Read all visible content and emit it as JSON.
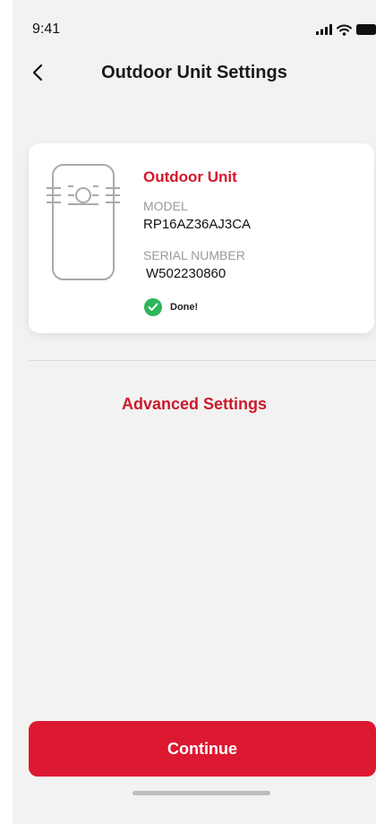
{
  "status_bar": {
    "time": "9:41",
    "icons": [
      "signal-icon",
      "wifi-icon",
      "battery-icon"
    ]
  },
  "nav": {
    "title": "Outdoor Unit Settings",
    "back_icon": "chevron-left-icon"
  },
  "unit_card": {
    "icon": "outdoor-unit-icon",
    "title": "Outdoor Unit",
    "model_label": "MODEL",
    "model_value": "RP16AZ36AJ3CA",
    "serial_label": "SERIAL NUMBER",
    "serial_value": "W502230860",
    "status_text": "Done!",
    "status_icon": "check-circle-icon"
  },
  "advanced_settings_label": "Advanced Settings",
  "continue_label": "Continue",
  "colors": {
    "accent": "#dd1831",
    "title_red": "#d6172a",
    "success": "#2fb55a",
    "background": "#f2f2f2"
  }
}
